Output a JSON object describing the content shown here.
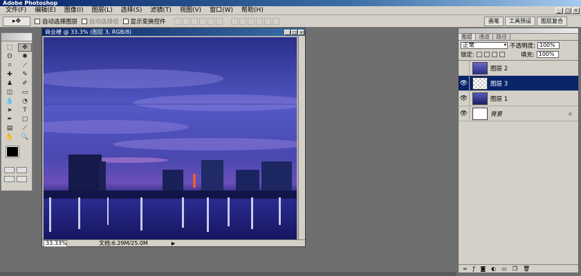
{
  "app": {
    "title": "Adobe Photoshop"
  },
  "menu": [
    "文件(F)",
    "编辑(E)",
    "图像(I)",
    "图层(L)",
    "选择(S)",
    "滤镜(T)",
    "视图(V)",
    "窗口(W)",
    "帮助(H)"
  ],
  "window_buttons": [
    "_",
    "□",
    "×"
  ],
  "options": {
    "auto_select_layer": "自动选择图层",
    "auto_select_group": "自动选择组",
    "show_transform": "显示变换控件",
    "palette_tabs": [
      "画笔",
      "工具预设",
      "图层复合"
    ]
  },
  "document": {
    "title": "商业楼 @ 33.3% (图层 3, RGB/8)",
    "zoom": "33.33%",
    "doc_info": "文档:6.29M/25.0M"
  },
  "layers_palette": {
    "tabs": [
      "图层",
      "通道",
      "路径"
    ],
    "blend_mode": "正常",
    "opacity_label": "不透明度:",
    "opacity_value": "100%",
    "lock_label": "锁定:",
    "fill_label": "填充:",
    "fill_value": "100%",
    "layers": [
      {
        "name": "图层 2",
        "visible": false,
        "selected": false
      },
      {
        "name": "图层 3",
        "visible": true,
        "selected": true
      },
      {
        "name": "图层 1",
        "visible": true,
        "selected": false
      },
      {
        "name": "背景",
        "visible": true,
        "selected": false,
        "locked": true
      }
    ]
  },
  "colors": {
    "accent": "#0a246a",
    "chrome": "#d4d0c8",
    "workspace": "#6f6f6f"
  }
}
